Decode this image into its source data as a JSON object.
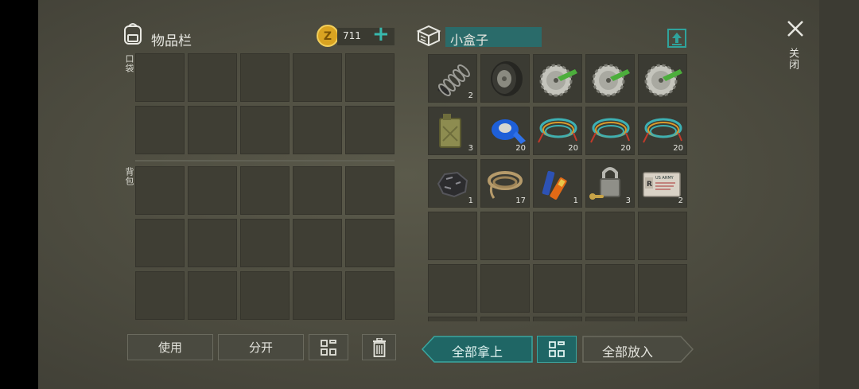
{
  "inventory": {
    "title": "物品栏",
    "icon": "backpack-icon",
    "coins": "711",
    "coin_icon": "zed-coin-icon",
    "add_label": "+",
    "pockets_label": "口袋",
    "backpack_label": "背包"
  },
  "container": {
    "icon": "box-icon",
    "name": "小盒子",
    "upload_icon": "upload-icon",
    "items": [
      {
        "name": "spring-icon",
        "count": "2"
      },
      {
        "name": "tire-icon",
        "count": ""
      },
      {
        "name": "saw-blade-icon",
        "count": ""
      },
      {
        "name": "saw-blade-icon",
        "count": ""
      },
      {
        "name": "saw-blade-icon",
        "count": ""
      },
      {
        "name": "jerry-can-icon",
        "count": "3"
      },
      {
        "name": "duct-tape-icon",
        "count": "20"
      },
      {
        "name": "wire-coil-icon",
        "count": "20"
      },
      {
        "name": "wire-coil-icon",
        "count": "20"
      },
      {
        "name": "wire-coil-icon",
        "count": "20"
      },
      {
        "name": "coal-icon",
        "count": "1"
      },
      {
        "name": "rope-icon",
        "count": "17"
      },
      {
        "name": "battery-icon",
        "count": "1"
      },
      {
        "name": "padlock-icon",
        "count": "3"
      },
      {
        "name": "army-id-card-icon",
        "count": "2"
      }
    ],
    "id_card_text": "US ARMY"
  },
  "close": {
    "icon": "close-icon",
    "label": "关闭"
  },
  "buttons": {
    "use": "使用",
    "split": "分开",
    "sort_icon": "grid-sort-icon",
    "trash_icon": "trash-icon",
    "take_all": "全部拿上",
    "put_all": "全部放入"
  },
  "colors": {
    "teal_accent": "#2fa39c",
    "background": "#4c4b3f",
    "slot": "#3f3e34"
  }
}
